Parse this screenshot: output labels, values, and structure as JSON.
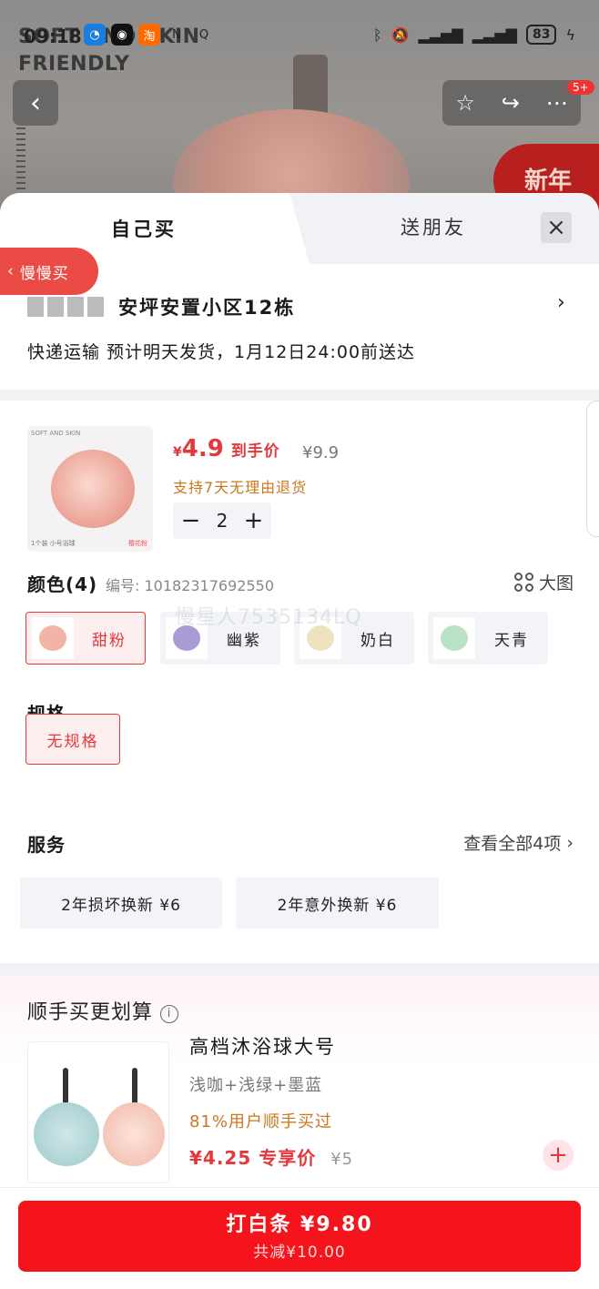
{
  "status_bar": {
    "time": "09:18",
    "battery": "83",
    "apps": [
      "bird-app",
      "qq-app",
      "taobao-app",
      "nfc",
      "q"
    ]
  },
  "background": {
    "brand_text": "SOFT AND SKIN\nFRIENDLY",
    "badge": "5+",
    "banner": "新年"
  },
  "tabs": {
    "self": "自己买",
    "friend": "送朋友"
  },
  "address": {
    "line": "安坪安置小区12栋",
    "shipping": "快递运输  预计明天发货，1月12日24:00前送达"
  },
  "product": {
    "thumb_top": "SOFT AND SKIN",
    "thumb_bottom_left": "1个装 小号浴球",
    "thumb_bottom_right": "樱花粉",
    "price_symbol": "¥",
    "price": "4.9",
    "price_tag": "到手价",
    "orig_price": "¥9.9",
    "return_note": "支持7天无理由退货",
    "qty": "2",
    "minus": "−",
    "plus": "+"
  },
  "slow_buy": "慢慢买",
  "color": {
    "title": "颜色(4)",
    "code": "编号: 10182317692550",
    "big_image": "大图",
    "options": [
      {
        "label": "甜粉",
        "swatch": "#f3b3a6",
        "selected": true
      },
      {
        "label": "幽紫",
        "swatch": "#a99bd4",
        "selected": false
      },
      {
        "label": "奶白",
        "swatch": "#efe2bf",
        "selected": false
      },
      {
        "label": "天青",
        "swatch": "#b9e2c5",
        "selected": false
      }
    ]
  },
  "watermark": "慢星人7535134LQ",
  "spec": {
    "title": "规格",
    "option": "无规格"
  },
  "service": {
    "title": "服务",
    "view_all": "查看全部4项",
    "options": [
      "2年损坏换新  ¥6",
      "2年意外换新  ¥6"
    ]
  },
  "addon": {
    "title": "顺手买更划算",
    "name": "高档沐浴球大号",
    "desc": "浅咖+浅绿+墨蓝",
    "percent": "81%用户顺手买过",
    "price": "¥4.25  专享价",
    "orig": "¥5"
  },
  "footer": {
    "pay_label": "打白条 ¥9.80",
    "saving": "共减¥10.00"
  },
  "colors": {
    "accent": "#e4393c",
    "pay_button": "#f5141c",
    "orange_note": "#c9781f"
  }
}
